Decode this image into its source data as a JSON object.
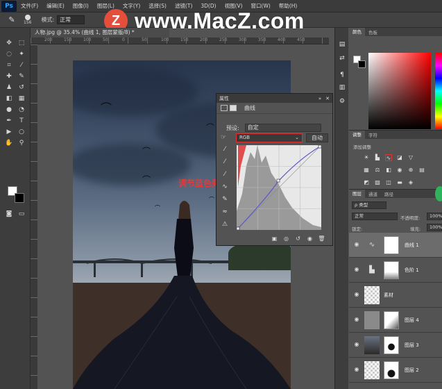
{
  "app": {
    "logo": "Ps"
  },
  "menu": [
    "文件(F)",
    "编辑(E)",
    "图像(I)",
    "图层(L)",
    "文字(Y)",
    "选择(S)",
    "滤镜(T)",
    "3D(D)",
    "视图(V)",
    "窗口(W)",
    "帮助(H)"
  ],
  "options": {
    "brush_size": "156",
    "mode_label": "模式:",
    "mode_value": "正常"
  },
  "watermark": {
    "logo": "Z",
    "text": "www.MacZ.com"
  },
  "document": {
    "tab_title": "人物.jpg @ 35.4% (曲线 1, 图层蒙版/8) *"
  },
  "ruler": [
    "200",
    "150",
    "100",
    "50",
    "0",
    "50",
    "100",
    "150",
    "200",
    "250",
    "300",
    "350",
    "400",
    "450"
  ],
  "canvas": {
    "annotation": "调节蓝色到RGB"
  },
  "properties": {
    "title": "属性",
    "header": "曲线",
    "preset_label": "预设:",
    "preset_value": "自定",
    "channel_value": "RGB",
    "auto_label": "自动"
  },
  "right_panel": {
    "color_tabs": [
      "颜色",
      "色板"
    ],
    "adjust_tabs": [
      "调整",
      "字符"
    ],
    "adjust_subtitle": "添加调整",
    "layers_tabs": [
      "图层",
      "通道",
      "路径"
    ],
    "kind_select": "ρ 类型",
    "blend_mode": "正常",
    "opacity_label": "不透明度:",
    "opacity_value": "100%",
    "lock_label": "锁定:",
    "fill_label": "填充:",
    "fill_value": "100%",
    "layers": [
      {
        "name": "曲线 1"
      },
      {
        "name": "色阶 1"
      },
      {
        "name": "素材"
      },
      {
        "name": "图层 4"
      },
      {
        "name": "图层 3"
      },
      {
        "name": "图层 2"
      }
    ]
  },
  "colors": {
    "accent_red": "#dd3333",
    "panel": "#535353",
    "ps_blue": "#31a8ff"
  },
  "icons": [
    "move-icon",
    "marquee-icon",
    "lasso-icon",
    "crop-icon",
    "brush-icon",
    "eyedropper-icon",
    "eye-icon",
    "curves-icon"
  ]
}
